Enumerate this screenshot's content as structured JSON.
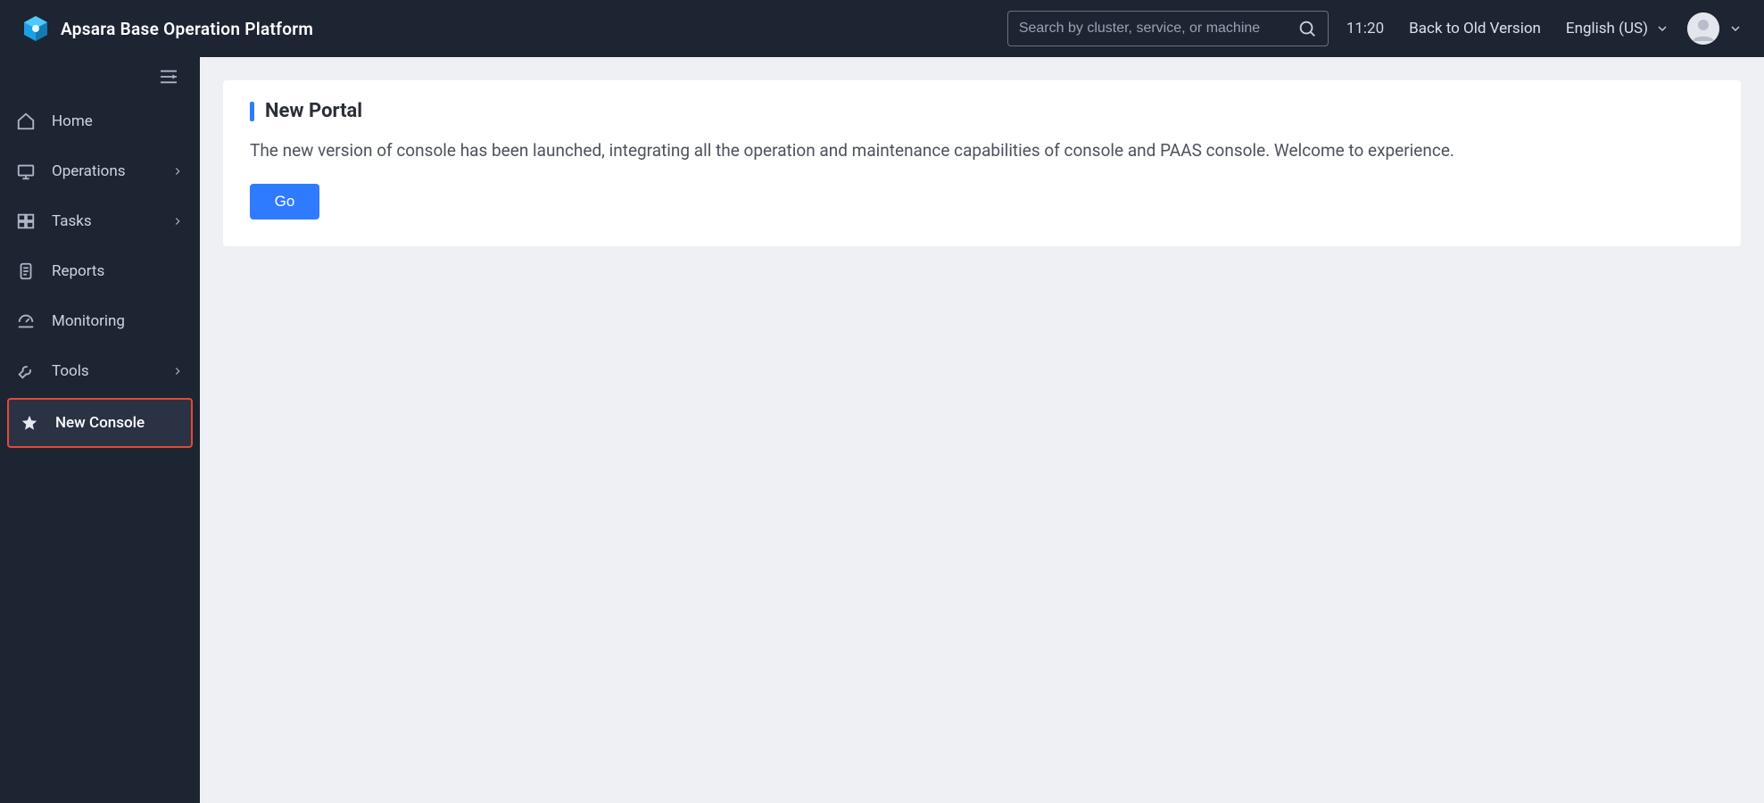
{
  "header": {
    "brand": "Apsara Base Operation Platform",
    "search_placeholder": "Search by cluster, service, or machine",
    "time": "11:20",
    "back_old": "Back to Old Version",
    "language": "English (US)"
  },
  "sidebar": {
    "items": [
      {
        "icon": "home-icon",
        "label": "Home",
        "expandable": false,
        "active": false,
        "highlight": false
      },
      {
        "icon": "operations-icon",
        "label": "Operations",
        "expandable": true,
        "active": false,
        "highlight": false
      },
      {
        "icon": "tasks-icon",
        "label": "Tasks",
        "expandable": true,
        "active": false,
        "highlight": false
      },
      {
        "icon": "reports-icon",
        "label": "Reports",
        "expandable": false,
        "active": false,
        "highlight": false
      },
      {
        "icon": "monitoring-icon",
        "label": "Monitoring",
        "expandable": false,
        "active": false,
        "highlight": false
      },
      {
        "icon": "tools-icon",
        "label": "Tools",
        "expandable": true,
        "active": false,
        "highlight": false
      },
      {
        "icon": "star-icon",
        "label": "New Console",
        "expandable": false,
        "active": true,
        "highlight": true
      }
    ]
  },
  "main": {
    "panel_title": "New Portal",
    "panel_desc": "The new version of console has been launched, integrating all the operation and maintenance capabilities of console and PAAS console. Welcome to experience.",
    "go_label": "Go"
  }
}
